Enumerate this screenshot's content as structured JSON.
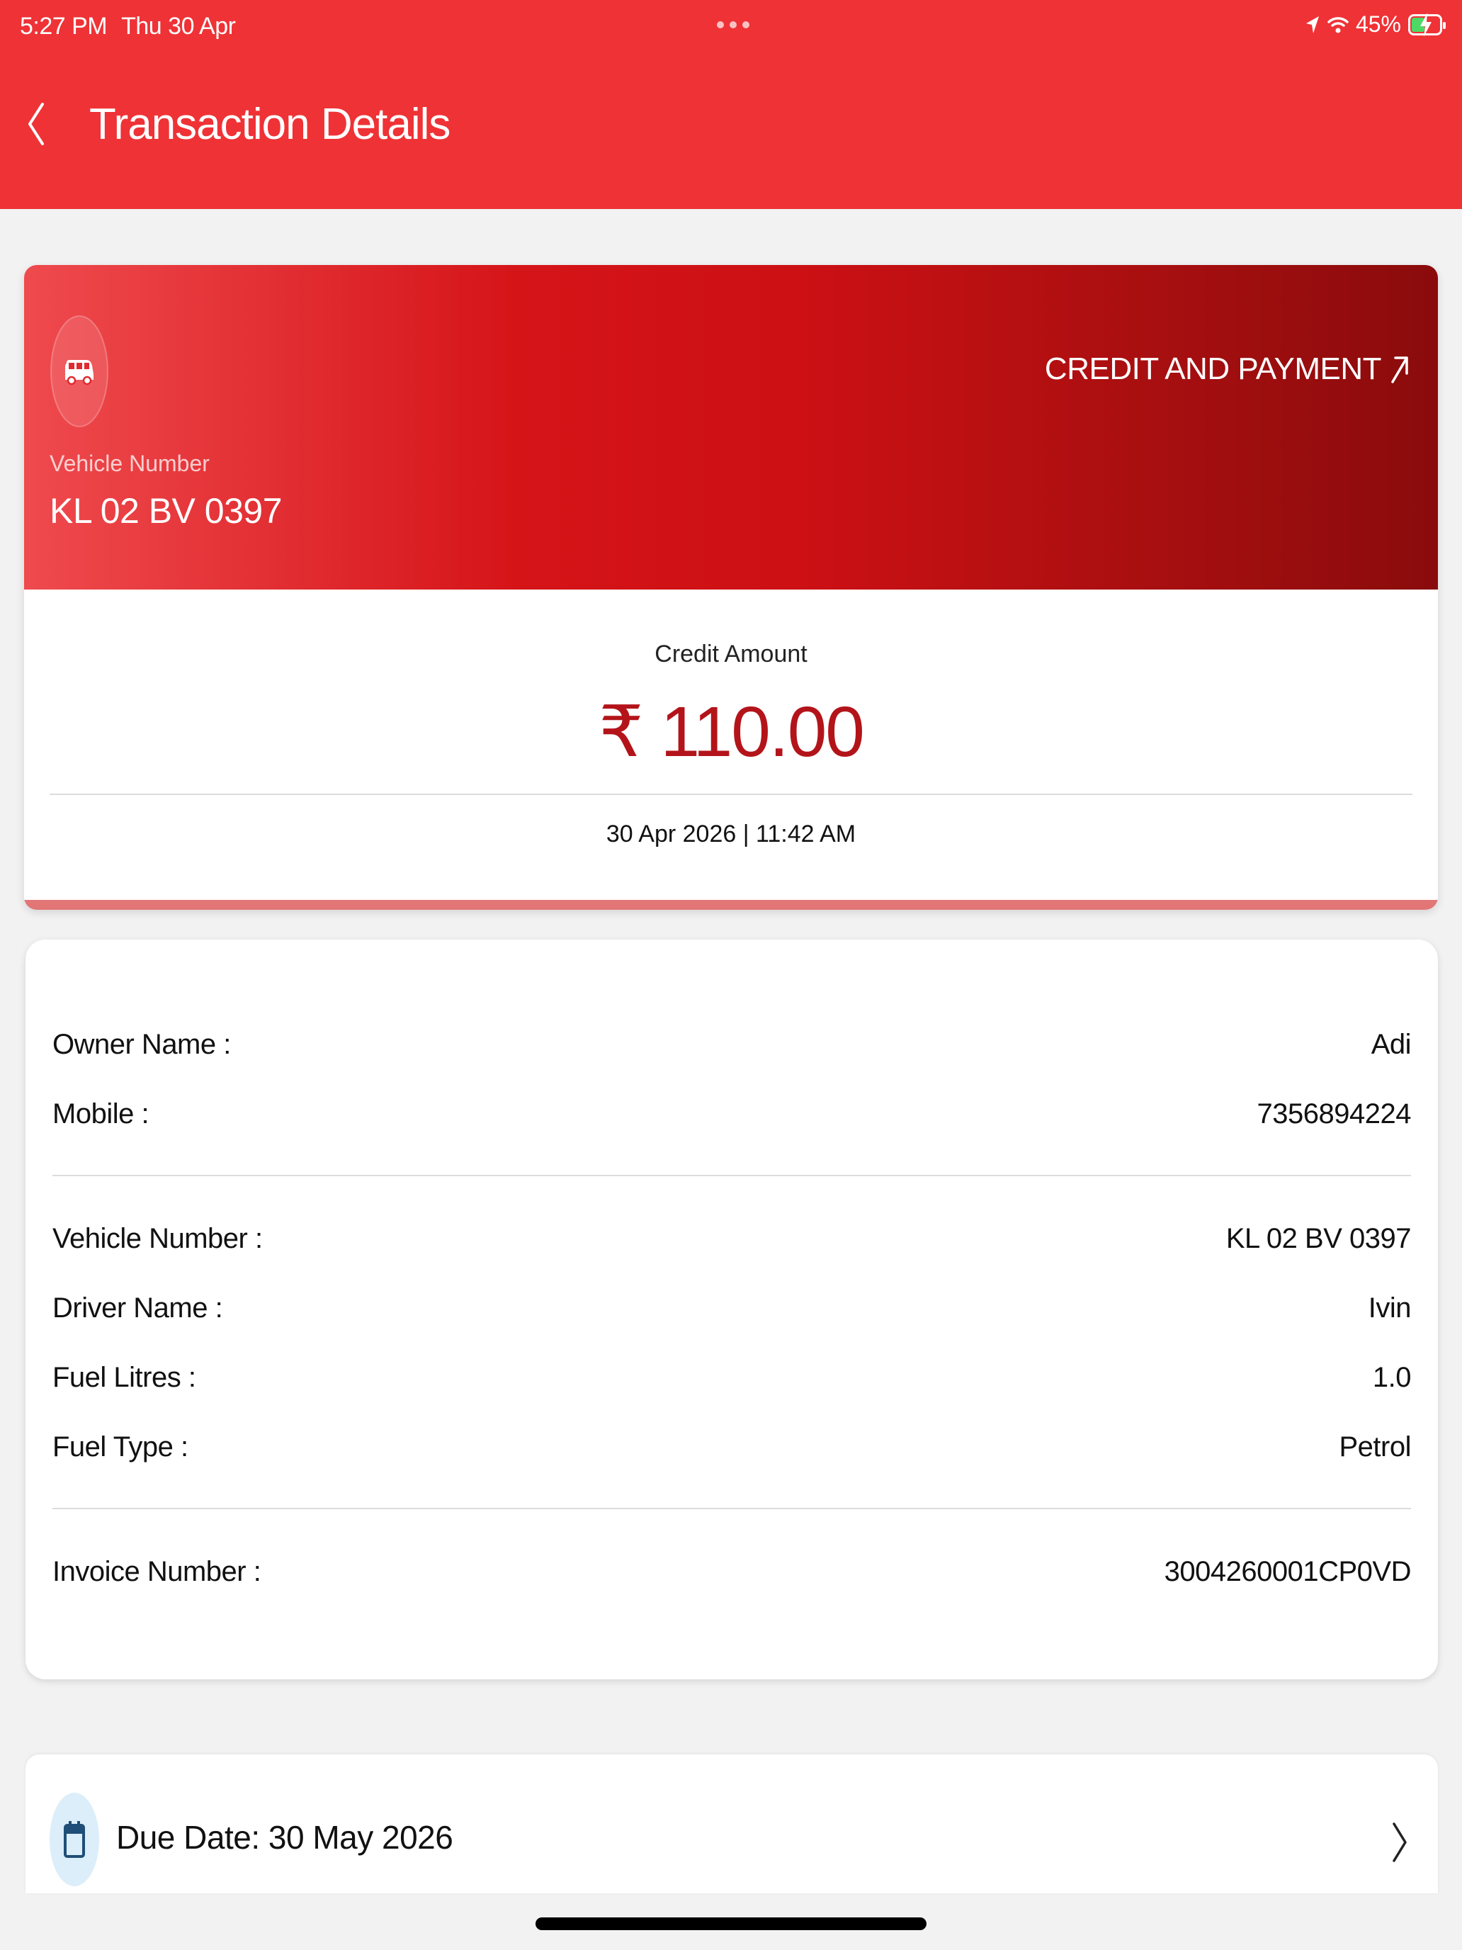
{
  "status_bar": {
    "time": "5:27 PM",
    "date": "Thu 30 Apr",
    "battery": "45%"
  },
  "header": {
    "title": "Transaction Details"
  },
  "transaction": {
    "vehicle_caption": "Vehicle Number",
    "vehicle_number": "KL 02 BV 0397",
    "credit_link_label": "CREDIT AND PAYMENT",
    "amount_label": "Credit Amount",
    "amount": "₹ 110.00",
    "datetime": "30 Apr 2026 | 11:42 AM"
  },
  "details": [
    {
      "label": "Owner Name :",
      "value": "Adi"
    },
    {
      "label": "Mobile :",
      "value": "7356894224"
    },
    {
      "label": "Vehicle Number :",
      "value": "KL 02 BV 0397"
    },
    {
      "label": "Driver Name :",
      "value": "Ivin"
    },
    {
      "label": "Fuel Litres :",
      "value": "1.0"
    },
    {
      "label": "Fuel Type :",
      "value": "Petrol"
    },
    {
      "label": "Invoice Number :",
      "value": "3004260001CP0VD"
    }
  ],
  "due": {
    "label": "Due Date: 30 May 2026"
  },
  "colors": {
    "header": "#ef3236",
    "amount": "#b3141a",
    "due_icon_bg": "#dbeefa",
    "due_icon": "#1f4f78"
  },
  "icons": {
    "back": "chevron-left-icon",
    "vehicle": "van-icon",
    "external": "arrow-up-right-icon",
    "calendar": "calendar-icon",
    "chevron": "chevron-right-icon"
  }
}
